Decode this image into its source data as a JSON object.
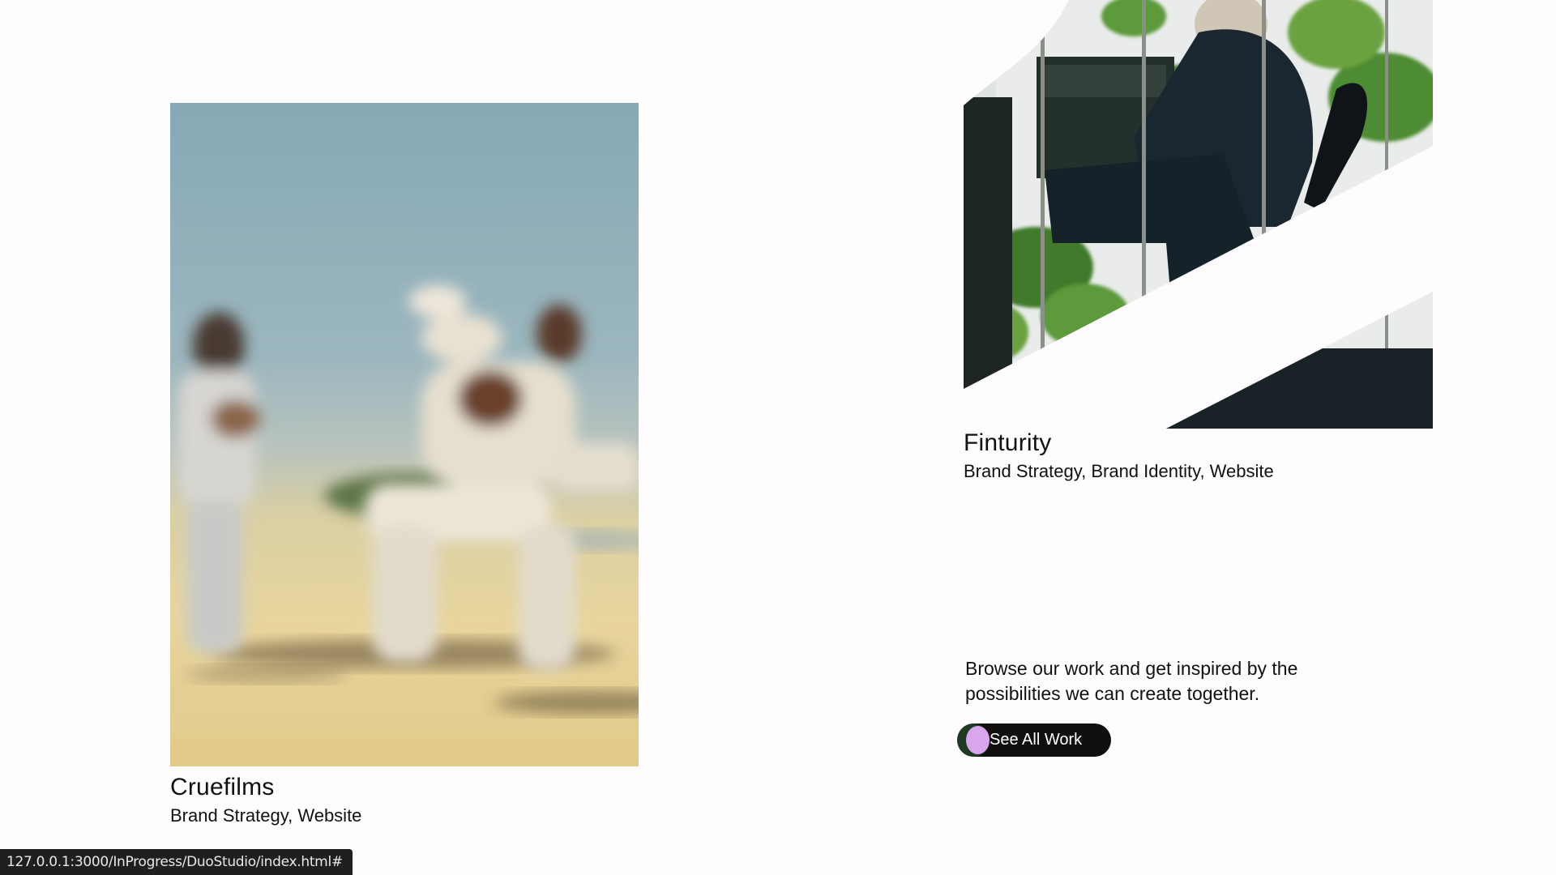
{
  "projects": [
    {
      "title": "Cruefilms",
      "tags": "Brand Strategy, Website"
    },
    {
      "title": "Finturity",
      "tags": "Brand Strategy, Brand Identity, Website"
    }
  ],
  "browse": {
    "text": "Browse our work and get inspired by the possibilities we can create together.",
    "button_label": "See All Work"
  },
  "status_bar": {
    "url": "127.0.0.1:3000/InProgress/DuoStudio/index.html#"
  },
  "colors": {
    "background": "#fefcfd",
    "button_bg": "#12100f",
    "button_dot": "#d9a6ee",
    "button_dot_ring": "#1e3a22",
    "status_bg": "#1f1f1f"
  }
}
